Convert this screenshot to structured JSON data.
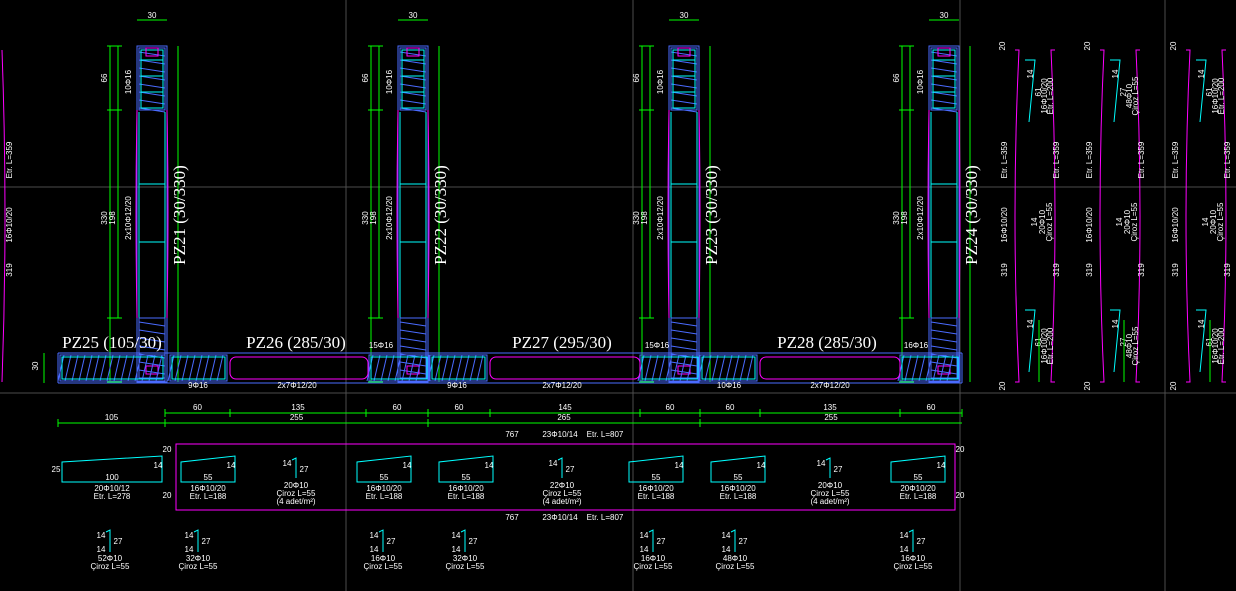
{
  "colors": {
    "background": "#000000",
    "dimension": "#00ff00",
    "outline": "#ff00ff",
    "concrete": "#4a6bff",
    "rebar": "#00ffff",
    "grid": "#555555",
    "text": "#ffffff"
  },
  "walls": [
    {
      "label": "PZ21 (30/330)",
      "bar_label": "10Φ16",
      "mesh_label": "2x10Φ12/20",
      "dim_total": "330",
      "dim_inner": "198",
      "dim_top": "66",
      "dim_width": "30"
    },
    {
      "label": "PZ22 (30/330)",
      "bar_label": "10Φ16",
      "mesh_label": "2x10Φ12/20",
      "dim_total": "330",
      "dim_inner": "198",
      "dim_top": "66",
      "dim_width": "30"
    },
    {
      "label": "PZ23 (30/330)",
      "bar_label": "10Φ16",
      "mesh_label": "2x10Φ12/20",
      "dim_total": "330",
      "dim_inner": "198",
      "dim_top": "66",
      "dim_width": "30"
    },
    {
      "label": "PZ24 (30/330)",
      "bar_label": "10Φ16",
      "mesh_label": "2x10Φ12/20",
      "dim_total": "330",
      "dim_inner": "198",
      "dim_top": "66",
      "dim_width": "30"
    }
  ],
  "beams": [
    {
      "label": "PZ25 (105/30)"
    },
    {
      "label": "PZ26 (285/30)",
      "bar_left": "9Φ16",
      "mesh": "2x7Φ12/20"
    },
    {
      "label": "PZ27 (295/30)",
      "bar_left": "9Φ16",
      "mesh": "2x7Φ12/20",
      "bar_top": "15Φ16"
    },
    {
      "label": "PZ28 (285/30)",
      "bar_left": "10Φ16",
      "mesh": "2x7Φ12/20",
      "bar_top": "16Φ16"
    }
  ],
  "joint_labels": [
    "15Φ16",
    "15Φ16",
    "16Φ16"
  ],
  "dims_row1": [
    "60",
    "135",
    "60",
    "60",
    "145",
    "60",
    "60",
    "135",
    "60"
  ],
  "dims_row2": [
    "105",
    "255",
    "265",
    "255"
  ],
  "dim_left_30": "30",
  "main_bar": {
    "length": "767",
    "spec": "23Φ10/14",
    "etr": "Etr. L=807"
  },
  "stirrups": [
    {
      "count": "20Φ10/12",
      "etr": "Etr. L=278",
      "a": "25",
      "b": "100",
      "c": "14"
    },
    {
      "count": "16Φ10/20",
      "etr": "Etr. L=188",
      "a": "",
      "b": "55",
      "c": "14"
    },
    {
      "count": "16Φ10/20",
      "etr": "Etr. L=188",
      "a": "",
      "b": "55",
      "c": "14"
    },
    {
      "count": "16Φ10/20",
      "etr": "Etr. L=188",
      "a": "",
      "b": "55",
      "c": "14"
    },
    {
      "count": "16Φ10/20",
      "etr": "Etr. L=188",
      "a": "",
      "b": "55",
      "c": "14"
    },
    {
      "count": "16Φ10/20",
      "etr": "Etr. L=188",
      "a": "",
      "b": "55",
      "c": "14"
    },
    {
      "count": "20Φ10/20",
      "etr": "Etr. L=188",
      "a": "",
      "b": "55",
      "c": "14"
    }
  ],
  "cirozes": [
    {
      "count": "20Φ10",
      "len": "Çiroz L=55",
      "note": "(4 adet/m²)"
    },
    {
      "count": "22Φ10",
      "len": "Çiroz L=55",
      "note": "(4 adet/m²)"
    },
    {
      "count": "20Φ10",
      "len": "Çiroz L=55",
      "note": "(4 adet/m²)"
    }
  ],
  "bottom_cirozes": [
    {
      "count": "52Φ10",
      "len": "Çiroz L=55"
    },
    {
      "count": "32Φ10",
      "len": "Çiroz L=55"
    },
    {
      "count": "16Φ10",
      "len": "Çiroz L=55"
    },
    {
      "count": "32Φ10",
      "len": "Çiroz L=55"
    },
    {
      "count": "16Φ10",
      "len": "Çiroz L=55"
    },
    {
      "count": "48Φ10",
      "len": "Çiroz L=55"
    },
    {
      "count": "16Φ10",
      "len": "Çiroz L=55"
    }
  ],
  "right_panels": [
    {
      "top": "20",
      "len": "319",
      "bar": "16Φ10/20",
      "etr": "Etr. L=359",
      "a": "14",
      "b": "61",
      "spec": "16Φ10/20",
      "etr2": "Etr. L=200",
      "bottom": "20"
    },
    {
      "top": "20",
      "len": "319",
      "bar": "16Φ10/20",
      "etr": "Etr. L=359",
      "a": "14",
      "b": "27",
      "spec": "48Φ10",
      "etr2": "Çiroz L=55",
      "bottom": "20"
    },
    {
      "top": "20",
      "len": "319",
      "bar": "16Φ10/20",
      "etr": "Etr. L=359",
      "a": "14",
      "b": "61",
      "spec": "16Φ10/20",
      "etr2": "Etr. L=200",
      "bottom": "20"
    }
  ],
  "left_edge": {
    "len": "319",
    "bar": "16Φ10/20",
    "etr": "Etr. L=359"
  }
}
